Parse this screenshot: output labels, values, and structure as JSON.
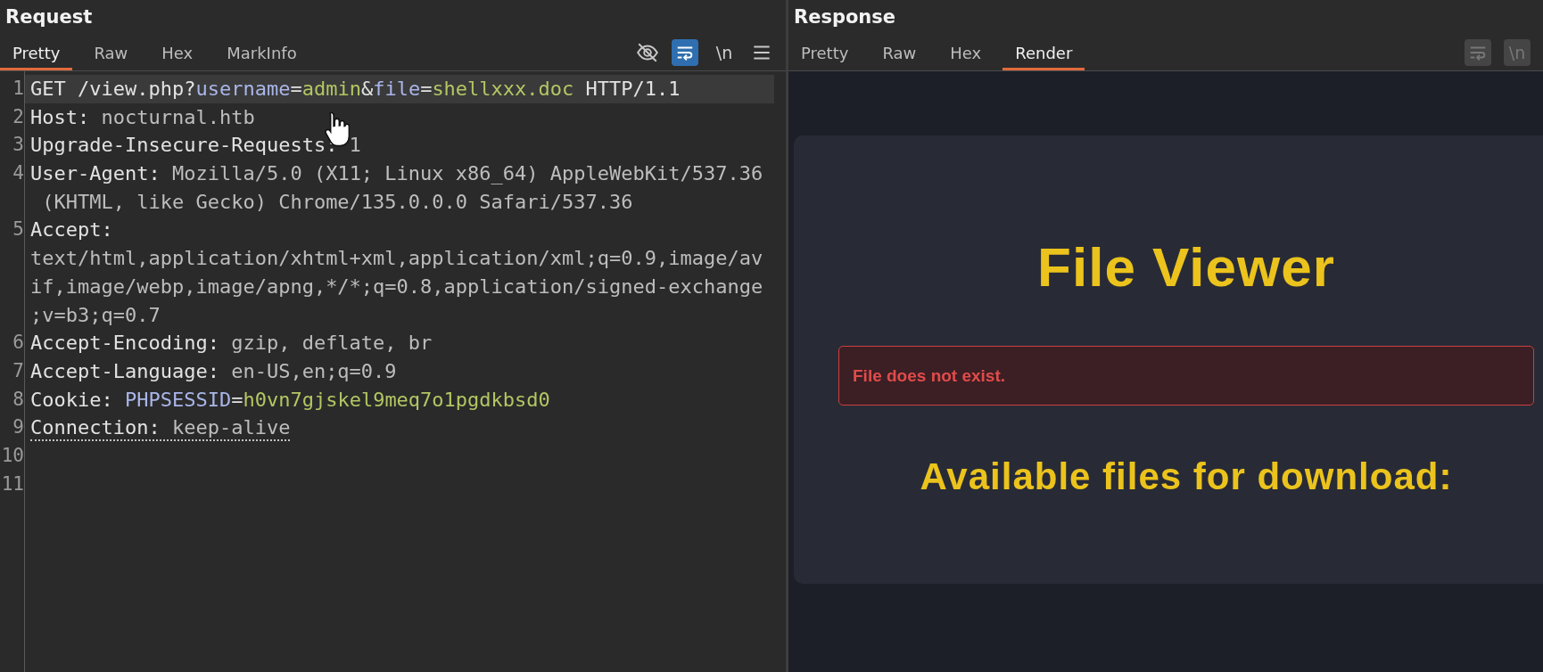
{
  "request": {
    "title": "Request",
    "tabs": [
      {
        "label": "Pretty",
        "selected": true
      },
      {
        "label": "Raw",
        "selected": false
      },
      {
        "label": "Hex",
        "selected": false
      },
      {
        "label": "MarkInfo",
        "selected": false
      }
    ],
    "tools": [
      {
        "kind": "hide"
      },
      {
        "kind": "wrap",
        "on": true,
        "disabled": false
      },
      {
        "kind": "newline",
        "label": "\\n",
        "on": false,
        "disabled": false
      },
      {
        "kind": "menu"
      }
    ],
    "lines": [
      {
        "number": "1",
        "current": true,
        "marked": false,
        "parts": [
          {
            "kind": "plain",
            "text": "GET /view.php?"
          },
          {
            "kind": "param",
            "text": "username"
          },
          {
            "kind": "plain",
            "text": "="
          },
          {
            "kind": "arg",
            "text": "admin"
          },
          {
            "kind": "plain",
            "text": "&"
          },
          {
            "kind": "param",
            "text": "file"
          },
          {
            "kind": "plain",
            "text": "="
          },
          {
            "kind": "arg",
            "text": "shellxxx.doc"
          },
          {
            "kind": "plain",
            "text": " HTTP/1.1"
          }
        ]
      },
      {
        "number": "2",
        "current": false,
        "marked": false,
        "parts": [
          {
            "kind": "name",
            "text": "Host:"
          },
          {
            "kind": "value",
            "text": " nocturnal.htb"
          }
        ]
      },
      {
        "number": "3",
        "current": false,
        "marked": false,
        "parts": [
          {
            "kind": "name",
            "text": "Upgrade-Insecure-Requests:"
          },
          {
            "kind": "value",
            "text": " 1"
          }
        ]
      },
      {
        "number": "4",
        "current": false,
        "marked": false,
        "parts": [
          {
            "kind": "name",
            "text": "User-Agent:"
          },
          {
            "kind": "value",
            "text": " Mozilla/5.0 (X11; Linux x86_64) AppleWebKit/537.36"
          }
        ],
        "wraps": [
          " (KHTML, like Gecko) Chrome/135.0.0.0 Safari/537.36"
        ]
      },
      {
        "number": "5",
        "current": false,
        "marked": false,
        "parts": [
          {
            "kind": "name",
            "text": "Accept:"
          }
        ],
        "wraps": [
          "text/html,application/xhtml+xml,application/xml;q=0.9,image/av",
          "if,image/webp,image/apng,*/*;q=0.8,application/signed-exchange",
          ";v=b3;q=0.7"
        ]
      },
      {
        "number": "6",
        "current": false,
        "marked": false,
        "parts": [
          {
            "kind": "name",
            "text": "Accept-Encoding:"
          },
          {
            "kind": "value",
            "text": " gzip, deflate, br"
          }
        ]
      },
      {
        "number": "7",
        "current": false,
        "marked": false,
        "parts": [
          {
            "kind": "name",
            "text": "Accept-Language:"
          },
          {
            "kind": "value",
            "text": " en-US,en;q=0.9"
          }
        ]
      },
      {
        "number": "8",
        "current": false,
        "marked": false,
        "parts": [
          {
            "kind": "name",
            "text": "Cookie: "
          },
          {
            "kind": "param",
            "text": "PHPSESSID"
          },
          {
            "kind": "plain",
            "text": "="
          },
          {
            "kind": "arg",
            "text": "h0vn7gjskel9meq7o1pgdkbsd0"
          }
        ]
      },
      {
        "number": "9",
        "current": false,
        "marked": true,
        "parts": [
          {
            "kind": "name",
            "text": "Connection:"
          },
          {
            "kind": "value",
            "text": " keep-alive"
          }
        ]
      },
      {
        "number": "10",
        "current": false
      },
      {
        "number": "11",
        "current": false
      }
    ]
  },
  "response": {
    "title": "Response",
    "tabs": [
      {
        "label": "Pretty",
        "selected": false
      },
      {
        "label": "Raw",
        "selected": false
      },
      {
        "label": "Hex",
        "selected": false
      },
      {
        "label": "Render",
        "selected": true
      }
    ],
    "tools": [
      {
        "kind": "wrap",
        "disabled": true
      },
      {
        "kind": "newline",
        "label": "\\n",
        "disabled": true
      }
    ],
    "render": {
      "heading": "File Viewer",
      "error": "File does not exist.",
      "subheading": "Available files for download:"
    }
  }
}
